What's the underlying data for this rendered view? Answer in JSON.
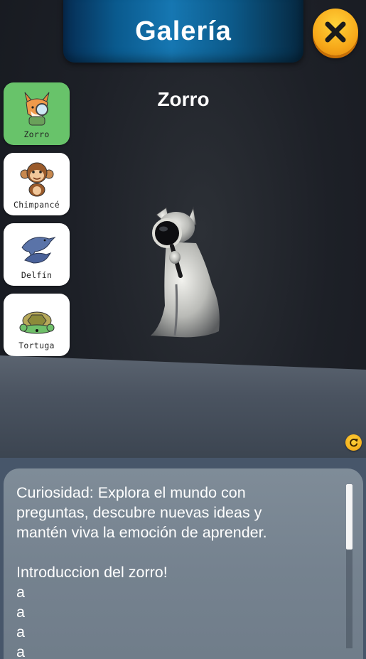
{
  "header": {
    "title": "Galería",
    "close_icon": "close-x-icon"
  },
  "sidebar": {
    "items": [
      {
        "label": "Zorro",
        "icon": "fox-icon",
        "selected": true
      },
      {
        "label": "Chimpancé",
        "icon": "monkey-icon",
        "selected": false
      },
      {
        "label": "Delfín",
        "icon": "dolphin-icon",
        "selected": false
      },
      {
        "label": "Tortuga",
        "icon": "turtle-icon",
        "selected": false
      }
    ]
  },
  "viewer": {
    "animal_name": "Zorro",
    "model": "fox-statue-with-magnifier",
    "rotate_icon": "rotate-icon"
  },
  "info": {
    "lines": [
      "Curiosidad: Explora el mundo con",
      "preguntas, descubre nuevas ideas y",
      "mantén viva la emoción de aprender.",
      "",
      "Introduccion del zorro!",
      "a",
      "a",
      "a",
      "a"
    ]
  },
  "colors": {
    "selected_card": "#68c36a",
    "accent_yellow": "#f7a91a",
    "banner_blue": "#1677b2"
  }
}
